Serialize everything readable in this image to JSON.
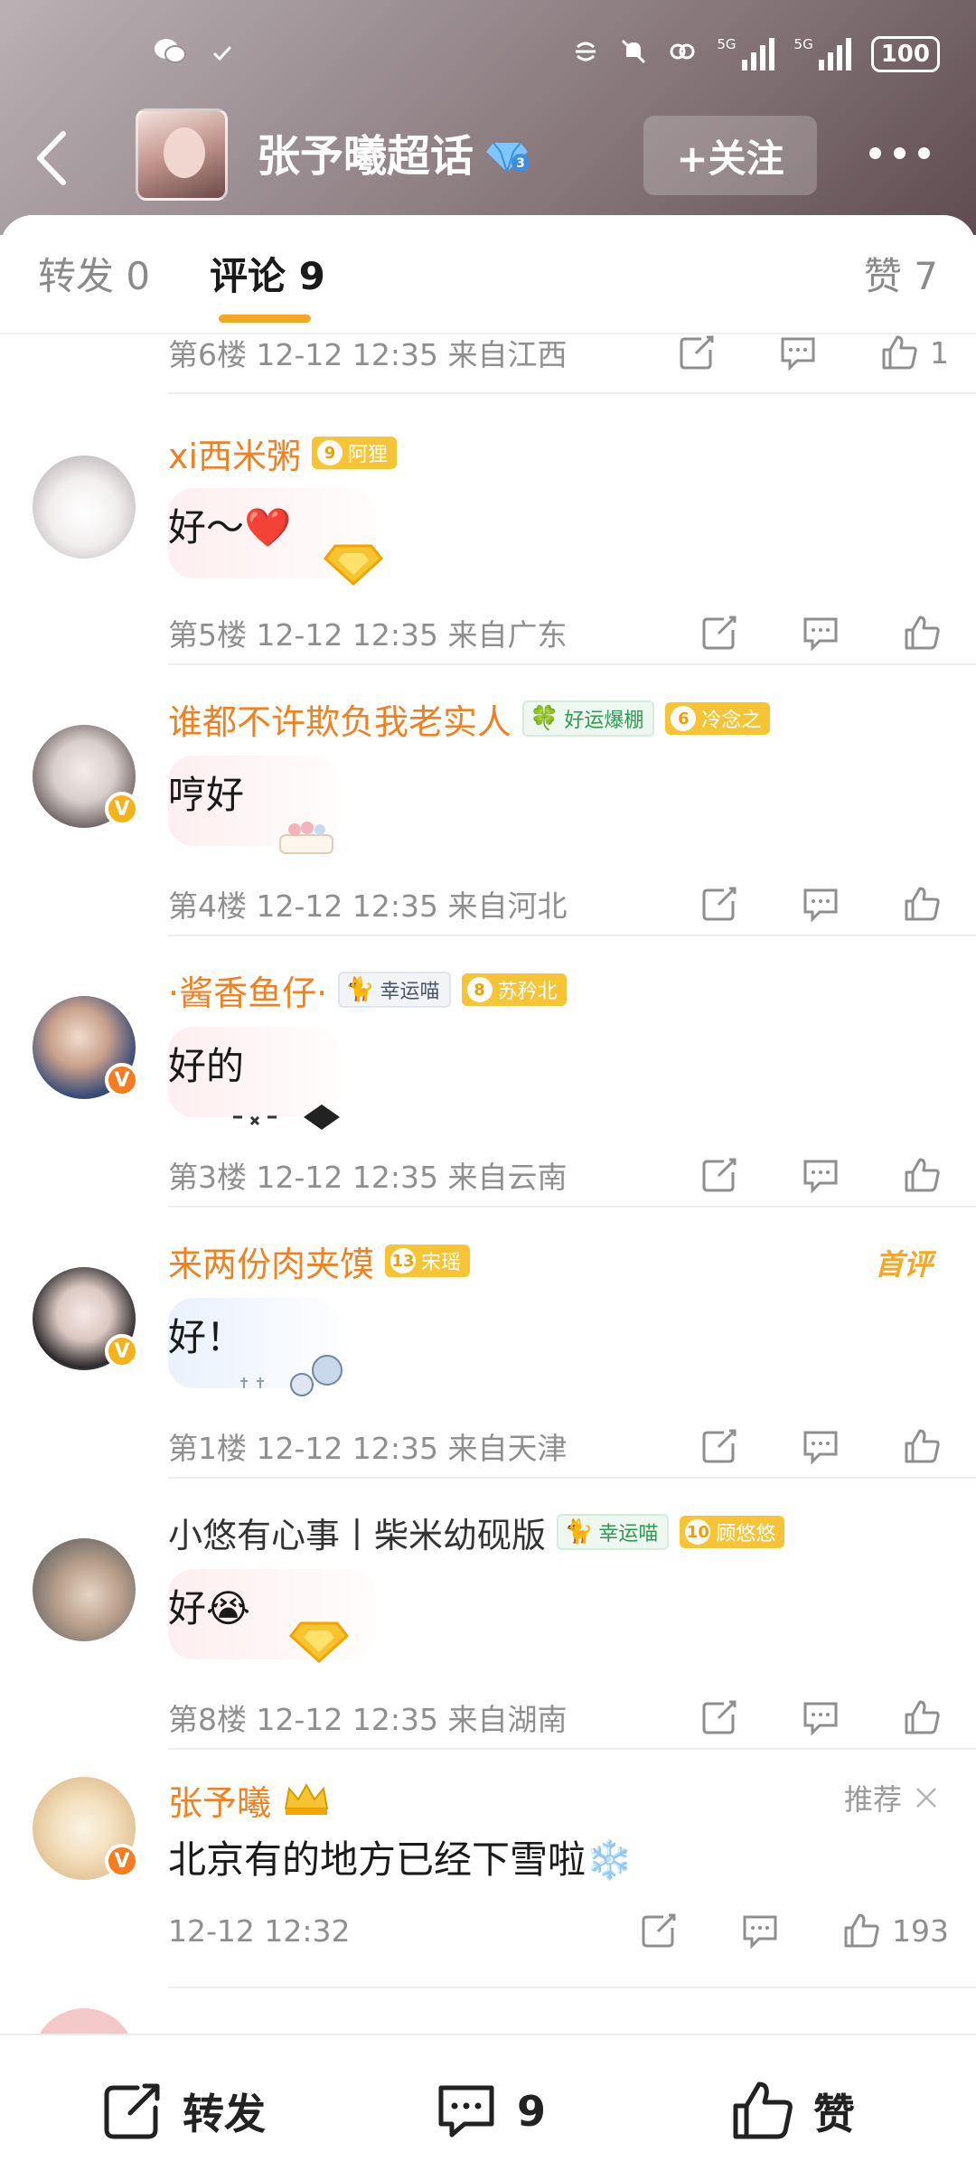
{
  "status": {
    "battery": "100",
    "signal1": "5G",
    "signal2": "5G"
  },
  "nav": {
    "topic_title": "张予曦超话",
    "topic_badge_level": "3",
    "follow_label": "+关注"
  },
  "tabs": {
    "repost": "转发 0",
    "comment": "评论 9",
    "like": "赞 7"
  },
  "top_meta": {
    "text": "第6楼  12-12 12:35  来自江西",
    "likes": "1"
  },
  "comments": [
    {
      "name": "xi西米粥",
      "fan_level": "9",
      "fan_name": "阿狸",
      "body": "好～❤️",
      "meta": "第5楼  12-12 12:35  来自广东"
    },
    {
      "name": "谁都不许欺负我老实人",
      "tag": "好运爆棚",
      "fan_level": "6",
      "fan_name": "冷念之",
      "body": "哼好",
      "meta": "第4楼  12-12 12:35  来自河北"
    },
    {
      "name": "·酱香鱼仔·",
      "tag": "幸运喵",
      "fan_level": "8",
      "fan_name": "苏矜北",
      "body": "好的",
      "meta": "第3楼  12-12 12:35  来自云南"
    },
    {
      "name": "来两份肉夹馍",
      "fan_level": "13",
      "fan_name": "宋瑶",
      "first_label": "首评",
      "body": "好！",
      "meta": "第1楼  12-12 12:35  来自天津"
    },
    {
      "name": "小悠有心事丨柴米幼砚版",
      "tag": "幸运喵",
      "fan_level": "10",
      "fan_name": "顾悠悠",
      "body": "好😭",
      "meta": "第8楼  12-12 12:35  来自湖南"
    },
    {
      "name": "张予曦",
      "recommend": "推荐",
      "body": "北京有的地方已经下雪啦❄️",
      "meta": "12-12 12:32",
      "likes": "193"
    }
  ],
  "bottom_bar": {
    "repost": "转发",
    "comment_count": "9",
    "like": "赞"
  }
}
